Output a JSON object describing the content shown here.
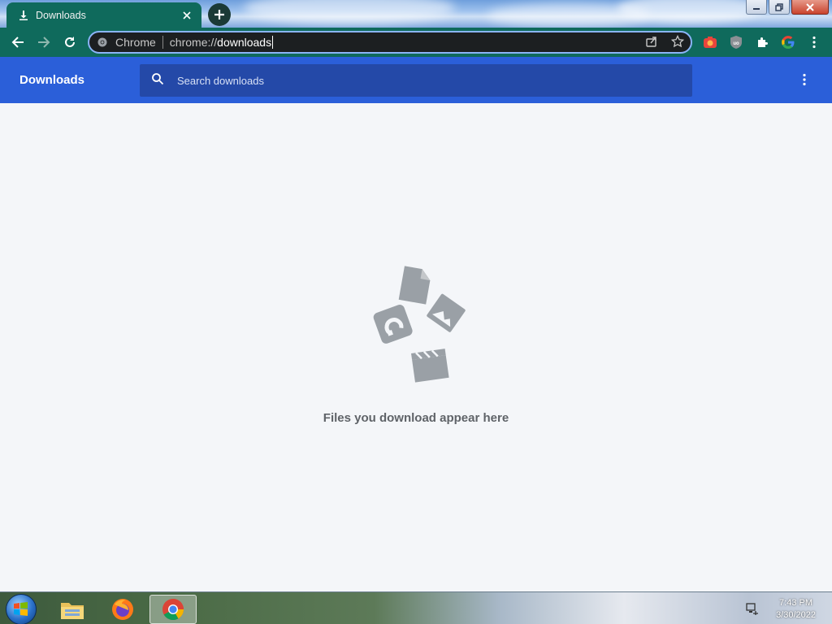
{
  "browser": {
    "tab": {
      "title": "Downloads",
      "icon": "download-icon"
    },
    "new_tab_icon": "plus-icon",
    "window_controls": [
      "minimize-icon",
      "restore-icon",
      "close-icon"
    ]
  },
  "toolbar": {
    "omnibox": {
      "site_name": "Chrome",
      "url_scheme": "chrome://",
      "url_path": "downloads"
    },
    "extensions": [
      "camera-extension-icon",
      "ublock-extension-icon",
      "puzzle-extensions-icon",
      "google-icon",
      "kebab-menu-icon"
    ]
  },
  "downloads_page": {
    "title": "Downloads",
    "search": {
      "placeholder": "Search downloads",
      "value": ""
    },
    "empty_message": "Files you download appear here"
  },
  "taskbar": {
    "clock": {
      "time": "7:43 PM",
      "date": "3/30/2022"
    },
    "pinned": [
      "file-explorer-icon",
      "firefox-icon",
      "chrome-icon"
    ],
    "active": "chrome-icon"
  },
  "colors": {
    "chrome_frame": "#0f6a5c",
    "downloads_header": "#2b5fd9",
    "search_bg": "#2449a8",
    "content_bg": "#f4f6f9",
    "illustration": "#9aa0a6"
  }
}
